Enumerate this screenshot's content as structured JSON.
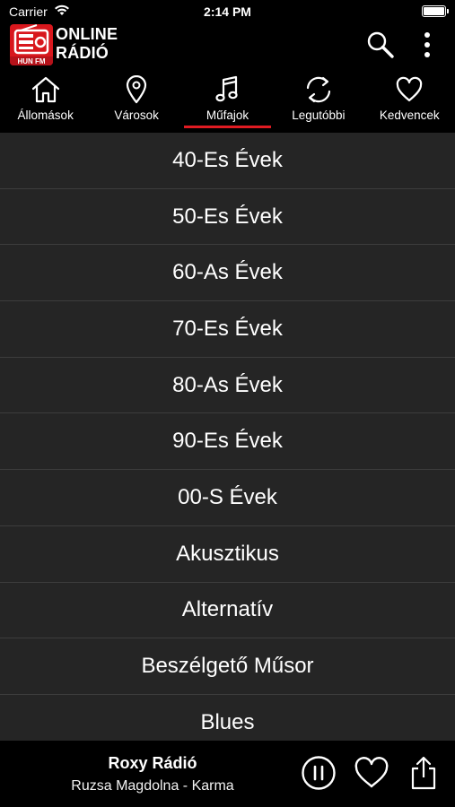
{
  "status_bar": {
    "carrier": "Carrier",
    "time": "2:14 PM"
  },
  "header": {
    "logo_badge": "HUN FM",
    "title_line1": "ONLINE",
    "title_line2": "RÁDIÓ",
    "icons": [
      "search-icon",
      "more-vertical-icon"
    ]
  },
  "tabs": [
    {
      "label": "Állomások",
      "icon": "home-icon"
    },
    {
      "label": "Városok",
      "icon": "map-pin-icon"
    },
    {
      "label": "Műfajok",
      "icon": "music-note-icon",
      "active": true
    },
    {
      "label": "Legutóbbi",
      "icon": "refresh-icon"
    },
    {
      "label": "Kedvencek",
      "icon": "heart-icon"
    }
  ],
  "genres": [
    "40-Es Évek",
    "50-Es Évek",
    "60-As Évek",
    "70-Es Évek",
    "80-As Évek",
    "90-Es Évek",
    "00-S Évek",
    "Akusztikus",
    "Alternatív",
    "Beszélgető Műsor",
    "Blues"
  ],
  "player": {
    "station": "Roxy Rádió",
    "track": "Ruzsa Magdolna - Karma",
    "icons": [
      "pause-icon",
      "heart-icon",
      "share-icon"
    ]
  },
  "colors": {
    "background": "#000000",
    "list_row": "#252525",
    "accent": "#e01b22",
    "logo_red": "#d8171d"
  }
}
